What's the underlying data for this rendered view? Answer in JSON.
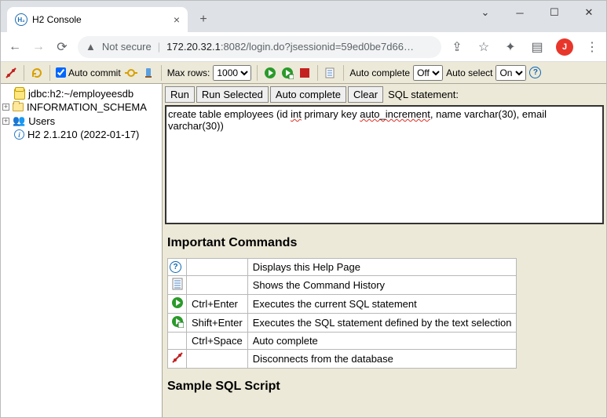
{
  "browser": {
    "tab_title": "H2 Console",
    "not_secure": "Not secure",
    "url_host": "172.20.32.1",
    "url_rest": ":8082/login.do?jsessionid=59ed0be7d66…",
    "avatar_initial": "J"
  },
  "toolbar": {
    "auto_commit": "Auto commit",
    "max_rows": "Max rows:",
    "max_rows_value": "1000",
    "auto_complete": "Auto complete",
    "auto_complete_value": "Off",
    "auto_select": "Auto select",
    "auto_select_value": "On"
  },
  "tree": {
    "db": "jdbc:h2:~/employeesdb",
    "schema": "INFORMATION_SCHEMA",
    "users": "Users",
    "version": "H2 2.1.210 (2022-01-17)"
  },
  "sql": {
    "run": "Run",
    "run_selected": "Run Selected",
    "auto_complete": "Auto complete",
    "clear": "Clear",
    "label": "SQL statement:",
    "text_pre": "create table employees (id ",
    "text_w1": "int",
    "text_mid": " primary key ",
    "text_w2": "auto_increment",
    "text_post": ", name varchar(30), email varchar(30))"
  },
  "commands": {
    "heading": "Important Commands",
    "rows": [
      {
        "key": "",
        "desc": "Displays this Help Page"
      },
      {
        "key": "",
        "desc": "Shows the Command History"
      },
      {
        "key": "Ctrl+Enter",
        "desc": "Executes the current SQL statement"
      },
      {
        "key": "Shift+Enter",
        "desc": "Executes the SQL statement defined by the text selection"
      },
      {
        "key": "Ctrl+Space",
        "desc": "Auto complete"
      },
      {
        "key": "",
        "desc": "Disconnects from the database"
      }
    ]
  },
  "sample": {
    "heading": "Sample SQL Script"
  }
}
